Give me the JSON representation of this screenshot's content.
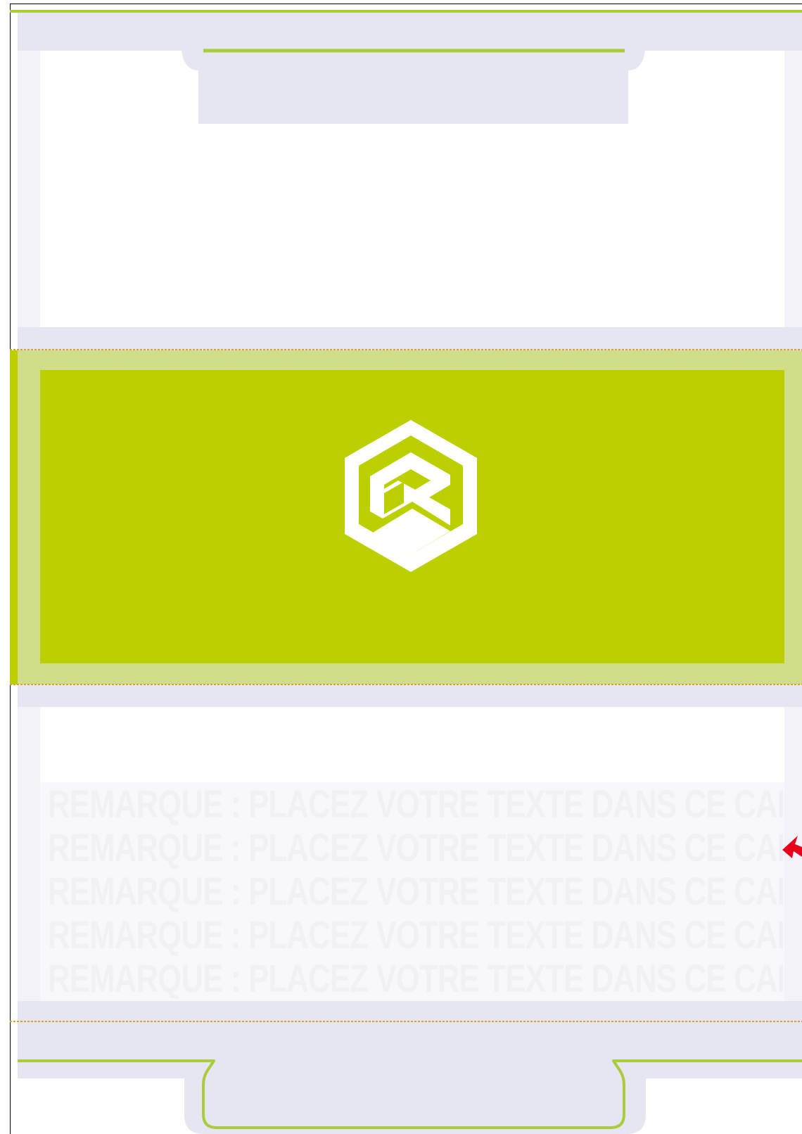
{
  "colors": {
    "accent_green": "#bcd000",
    "light_green": "#d0de8a",
    "line_green": "#a8cc3c",
    "lavender": "#e6e6f3",
    "pale_lavender": "#f2f2f8",
    "dotted_orange": "#d9a030",
    "watermark_text": "#f0f0f5",
    "arrow_red": "#e8001a"
  },
  "icons": {
    "logo": "hexagon-r-logo-icon",
    "arrow": "red-arrow-icon"
  },
  "watermark": {
    "lines": [
      "REMARQUE  :  PLACEZ  VOTRE  TEXTE  DANS  CE  CADRE",
      "REMARQUE  :  PLACEZ  VOTRE  TEXTE  DANS  CE  CADRE",
      "REMARQUE  :  PLACEZ  VOTRE  TEXTE  DANS  CE  CADRE",
      "REMARQUE  :  PLACEZ  VOTRE  TEXTE  DANS  CE  CADRE",
      "REMARQUE  :  PLACEZ  VOTRE  TEXTE  DANS  CE  CADR"
    ]
  }
}
